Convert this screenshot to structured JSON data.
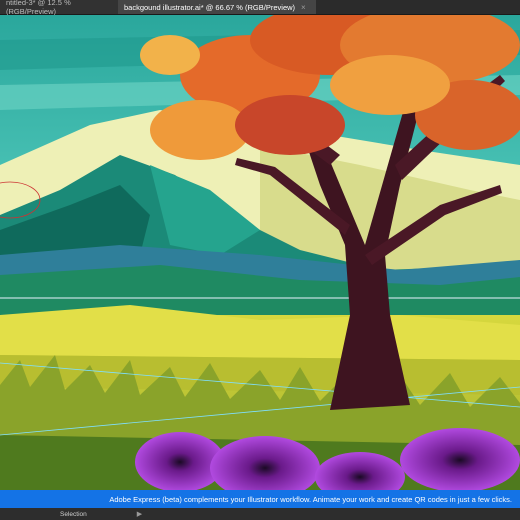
{
  "tabs": [
    {
      "label": "ntitled-3* @ 12.5 % (RGB/Preview)",
      "active": false
    },
    {
      "label": "backgound illustrator.ai* @ 66.67 % (RGB/Preview)",
      "active": true
    }
  ],
  "banner": {
    "text": "Adobe Express (beta) complements your Illustrator workflow. Animate your work and create QR codes in just a few clicks."
  },
  "status": {
    "tool": "Selection",
    "arrow": "▶"
  },
  "icons": {
    "close": "×"
  },
  "colors": {
    "sky": "#3ec6b3",
    "mountain_dark": "#127a6a",
    "meadow": "#c9cb3c",
    "trunk": "#3e1420",
    "foliage": "#e0642a",
    "flower": "#9b2fc6",
    "banner": "#1473e6"
  }
}
